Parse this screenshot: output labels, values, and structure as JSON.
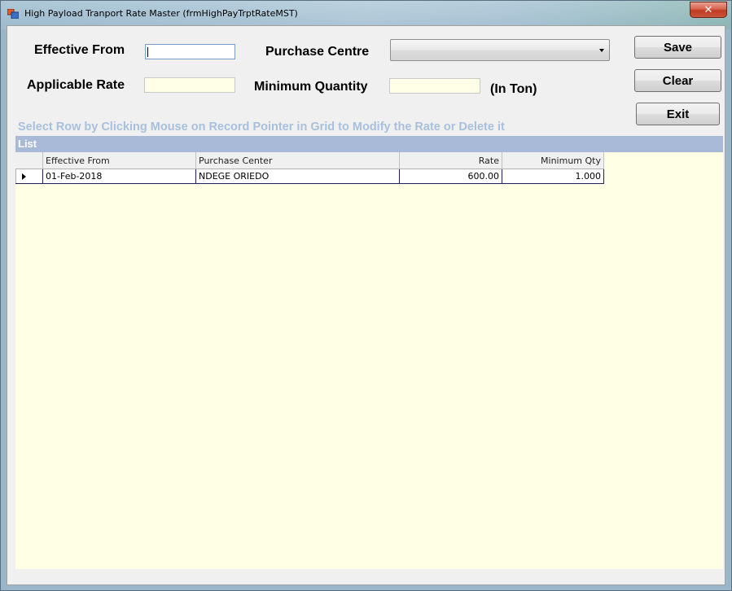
{
  "window": {
    "title": "High Payload Tranport Rate Master (frmHighPayTrptRateMST)",
    "close_glyph": "✕",
    "icon": "app-window-icon"
  },
  "form": {
    "effective_from_label": "Effective From",
    "effective_from_value": "",
    "purchase_centre_label": "Purchase Centre",
    "purchase_centre_value": "",
    "applicable_rate_label": "Applicable Rate",
    "applicable_rate_value": "",
    "minimum_quantity_label": "Minimum Quantity",
    "minimum_quantity_value": "",
    "unit_label": "(In Ton)"
  },
  "buttons": {
    "save": "Save",
    "clear": "Clear",
    "exit": "Exit"
  },
  "hint": "Select Row by Clicking Mouse on Record Pointer in Grid to Modify the Rate or Delete it",
  "list": {
    "header": "List",
    "columns": [
      "Effective From",
      "Purchase Center",
      "Rate",
      "Minimum Qty"
    ],
    "rows": [
      [
        "01-Feb-2018",
        "NDEGE ORIEDO",
        "600.00",
        "1.000"
      ]
    ]
  },
  "colors": {
    "list_header_bg": "#a9bad8",
    "grid_bg": "#ffffe6",
    "hint_text": "#a8c0dc",
    "input_bg": "#ffffe8"
  }
}
